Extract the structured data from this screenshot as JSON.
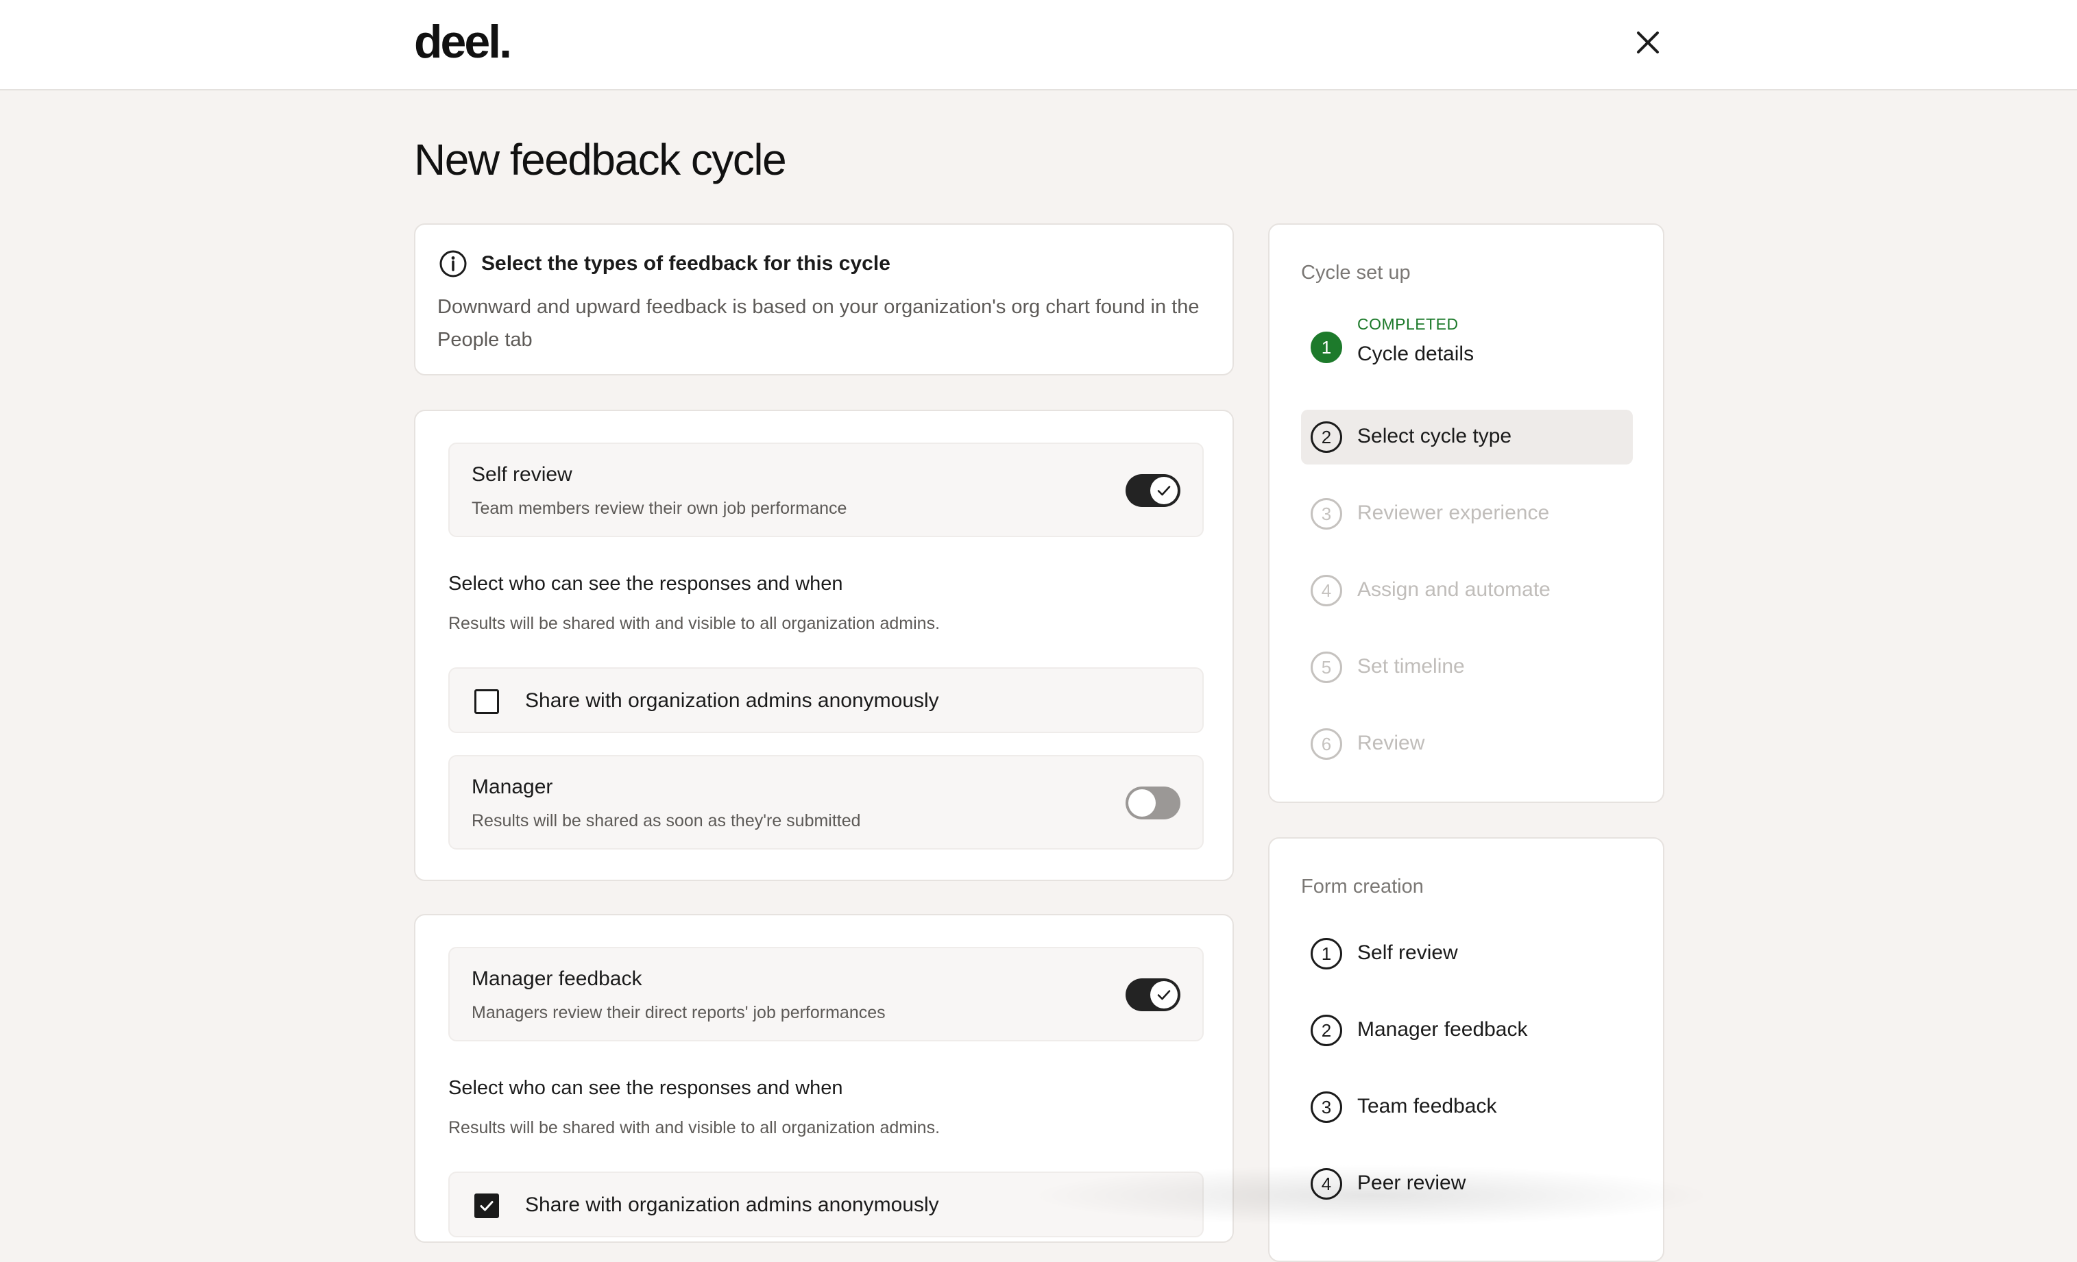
{
  "header": {
    "logo": "deel.",
    "close_icon": "close-icon"
  },
  "page": {
    "title": "New feedback cycle"
  },
  "info": {
    "icon": "info-icon",
    "title": "Select the types of feedback for this cycle",
    "body": "Downward and upward feedback is based on your organization's org chart found in the People tab"
  },
  "self_review": {
    "title": "Self review",
    "subtitle": "Team members review their own job performance",
    "enabled": true,
    "visibility_title": "Select who can see the responses and when",
    "visibility_sub": "Results will be shared with and visible to all organization admins.",
    "share_label": "Share with organization admins anonymously",
    "share_checked": false,
    "manager": {
      "title": "Manager",
      "subtitle": "Results will be shared as soon as they're submitted",
      "enabled": false
    }
  },
  "manager_feedback": {
    "title": "Manager feedback",
    "subtitle": "Managers review their direct reports' job performances",
    "enabled": true,
    "visibility_title": "Select who can see the responses and when",
    "visibility_sub": "Results will be shared with and visible to all organization admins.",
    "share_label": "Share with organization admins anonymously",
    "share_checked": true
  },
  "cycle_setup": {
    "title": "Cycle set up",
    "steps": [
      {
        "num": "1",
        "label": "Cycle details",
        "status": "COMPLETED"
      },
      {
        "num": "2",
        "label": "Select cycle type",
        "status": "active"
      },
      {
        "num": "3",
        "label": "Reviewer experience",
        "status": "pending"
      },
      {
        "num": "4",
        "label": "Assign and automate",
        "status": "pending"
      },
      {
        "num": "5",
        "label": "Set timeline",
        "status": "pending"
      },
      {
        "num": "6",
        "label": "Review",
        "status": "pending"
      }
    ]
  },
  "form_creation": {
    "title": "Form creation",
    "steps": [
      {
        "num": "1",
        "label": "Self review"
      },
      {
        "num": "2",
        "label": "Manager feedback"
      },
      {
        "num": "3",
        "label": "Team feedback"
      },
      {
        "num": "4",
        "label": "Peer review"
      }
    ]
  },
  "colors": {
    "completed": "#1d7a2b",
    "toggle_on": "#232323",
    "toggle_off": "#9b9896",
    "page_bg": "#f6f3f1"
  }
}
